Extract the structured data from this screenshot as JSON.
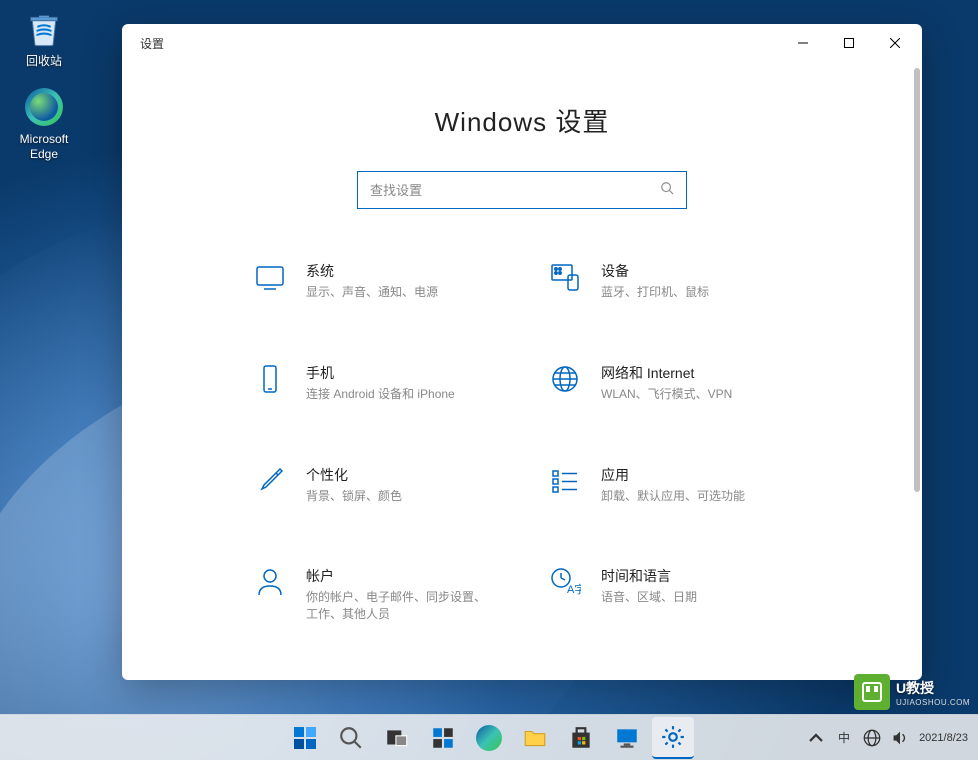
{
  "desktop": {
    "icons": [
      {
        "name": "recycle-bin",
        "label": "回收站"
      },
      {
        "name": "microsoft-edge",
        "label": "Microsoft Edge"
      }
    ]
  },
  "window": {
    "title": "设置",
    "heading": "Windows 设置",
    "search_placeholder": "查找设置",
    "categories": [
      {
        "id": "system",
        "title": "系统",
        "desc": "显示、声音、通知、电源"
      },
      {
        "id": "devices",
        "title": "设备",
        "desc": "蓝牙、打印机、鼠标"
      },
      {
        "id": "phone",
        "title": "手机",
        "desc": "连接 Android 设备和 iPhone"
      },
      {
        "id": "network",
        "title": "网络和 Internet",
        "desc": "WLAN、飞行模式、VPN"
      },
      {
        "id": "personalization",
        "title": "个性化",
        "desc": "背景、锁屏、颜色"
      },
      {
        "id": "apps",
        "title": "应用",
        "desc": "卸载、默认应用、可选功能"
      },
      {
        "id": "accounts",
        "title": "帐户",
        "desc": "你的帐户、电子邮件、同步设置、工作、其他人员"
      },
      {
        "id": "time-language",
        "title": "时间和语言",
        "desc": "语音、区域、日期"
      }
    ]
  },
  "taskbar": {
    "date": "2021/8/23"
  },
  "watermark": {
    "brand": "U教授",
    "sub": "UJIAOSHOU.COM"
  }
}
